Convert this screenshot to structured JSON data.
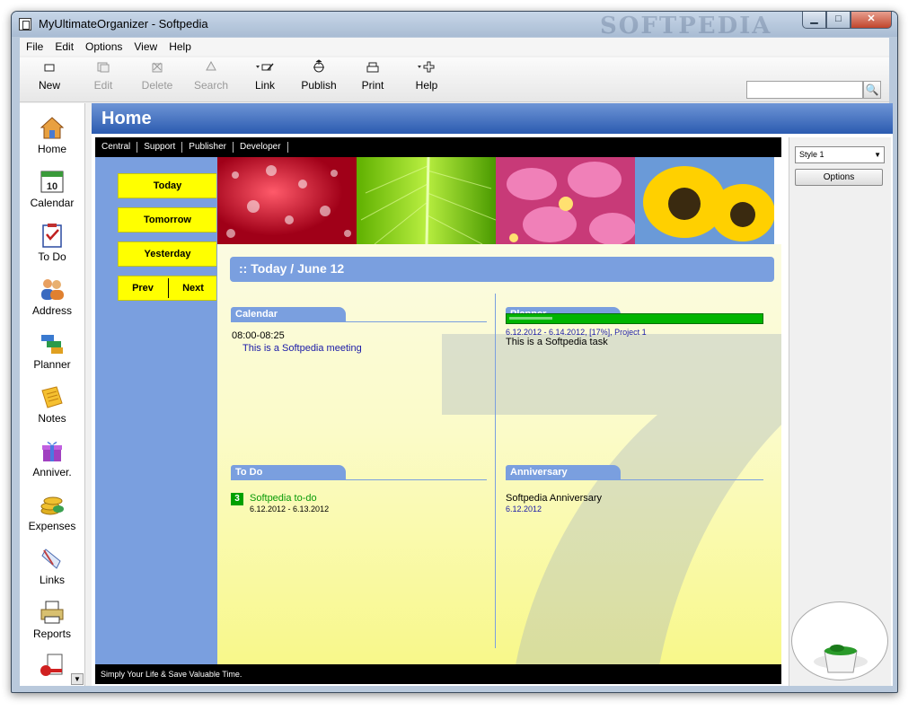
{
  "window": {
    "title": "MyUltimateOrganizer - Softpedia",
    "watermark": "SOFTPEDIA",
    "buttons": {
      "minimize": "▁",
      "maximize": "□",
      "close": "✕"
    }
  },
  "menu": [
    "File",
    "Edit",
    "Options",
    "View",
    "Help"
  ],
  "toolbar": [
    {
      "label": "New",
      "icon": "new-doc-icon",
      "enabled": true
    },
    {
      "label": "Edit",
      "icon": "edit-icon",
      "enabled": false
    },
    {
      "label": "Delete",
      "icon": "delete-icon",
      "enabled": false
    },
    {
      "label": "Search",
      "icon": "search-icon",
      "enabled": false
    },
    {
      "label": "Link",
      "icon": "link-icon",
      "enabled": true
    },
    {
      "label": "Publish",
      "icon": "publish-icon",
      "enabled": true
    },
    {
      "label": "Print",
      "icon": "print-icon",
      "enabled": true
    },
    {
      "label": "Help",
      "icon": "help-icon",
      "enabled": true
    }
  ],
  "search": {
    "value": "",
    "button": "🔍"
  },
  "nav": [
    "Home",
    "Calendar",
    "To Do",
    "Address",
    "Planner",
    "Notes",
    "Anniver.",
    "Expenses",
    "Links",
    "Reports"
  ],
  "nav_scroll": "▼",
  "header": {
    "title": "Home"
  },
  "topnav": [
    "Central",
    "Support",
    "Publisher",
    "Developer"
  ],
  "day_buttons": {
    "today": "Today",
    "tomorrow": "Tomorrow",
    "yesterday": "Yesterday",
    "prev": "Prev",
    "next": "Next"
  },
  "today_heading": ":: Today / June 12",
  "calendar": {
    "title": "Calendar",
    "time": "08:00-08:25",
    "event": "This is a Softpedia meeting"
  },
  "planner": {
    "title": "Planner",
    "progress_percent": 17,
    "dates": "6.12.2012 - 6.14.2012, [17%], Project 1",
    "task": "This is a Softpedia task"
  },
  "todo": {
    "title": "To Do",
    "badge": "3",
    "item": "Softpedia to-do",
    "dates": "6.12.2012 - 6.13.2012"
  },
  "anniversary": {
    "title": "Anniversary",
    "item": "Softpedia Anniversary",
    "date": "6.12.2012"
  },
  "footer": "Simply Your Life & Save Valuable Time.",
  "right": {
    "style_value": "Style 1",
    "options_label": "Options"
  }
}
